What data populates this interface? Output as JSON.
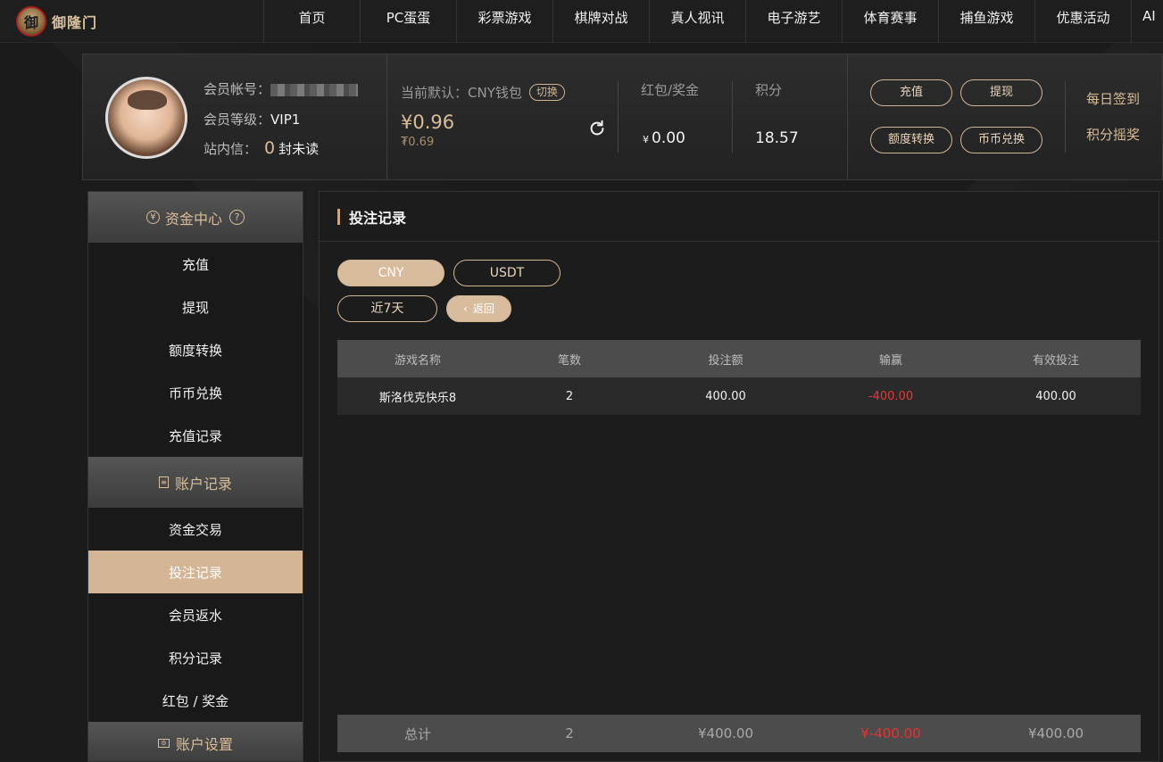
{
  "brand": {
    "logo_text": "御隆门"
  },
  "nav": {
    "items": [
      "首页",
      "PC蛋蛋",
      "彩票游戏",
      "棋牌对战",
      "真人视讯",
      "电子游艺",
      "体育赛事",
      "捕鱼游戏",
      "优惠活动",
      "AI"
    ]
  },
  "member": {
    "account_label": "会员帐号：",
    "level_label": "会员等级：",
    "level_value": "VIP1",
    "mail_label": "站内信：",
    "mail_count": "0",
    "mail_suffix": "封未读"
  },
  "wallet": {
    "label": "当前默认：CNY钱包",
    "switch_label": "切换",
    "amount": "¥0.96",
    "sub_amount": "₮0.69",
    "refresh_icon": "refresh-icon"
  },
  "stats": {
    "bonus_label": "红包/奖金",
    "bonus_currency": "¥",
    "bonus_value": "0.00",
    "points_label": "积分",
    "points_value": "18.57"
  },
  "actions": {
    "deposit": "充值",
    "withdraw": "提现",
    "transfer": "额度转换",
    "exchange": "币币兑换",
    "daily_signin": "每日签到",
    "points_lottery": "积分摇奖"
  },
  "sidebar": {
    "sections": [
      {
        "title": "资金中心",
        "icon": "money-icon",
        "help_icon": "help-icon",
        "items": [
          "充值",
          "提现",
          "额度转换",
          "币币兑换",
          "充值记录"
        ]
      },
      {
        "title": "账户记录",
        "icon": "record-icon",
        "items": [
          "资金交易",
          "投注记录",
          "会员返水",
          "积分记录",
          "红包 / 奖金"
        ]
      },
      {
        "title": "账户设置",
        "icon": "settings-icon",
        "items": []
      }
    ],
    "active": "投注记录"
  },
  "main": {
    "title": "投注记录",
    "currency_tabs": [
      "CNY",
      "USDT"
    ],
    "active_currency": "CNY",
    "period_label": "近7天",
    "back_label": "返回",
    "table": {
      "headers": [
        "游戏名称",
        "笔数",
        "投注额",
        "输赢",
        "有效投注"
      ],
      "rows": [
        [
          "斯洛伐克快乐8",
          "2",
          "400.00",
          "-400.00",
          "400.00"
        ]
      ],
      "totals": [
        "总计",
        "2",
        "¥400.00",
        "¥-400.00",
        "¥400.00"
      ]
    }
  },
  "colors": {
    "accent": "#d4b697",
    "negative": "#e23b3b"
  }
}
